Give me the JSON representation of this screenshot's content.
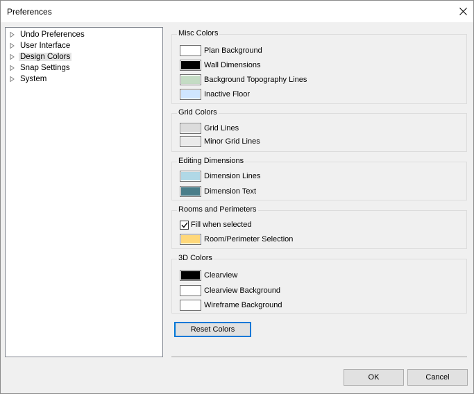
{
  "window": {
    "title": "Preferences",
    "close_icon": "close-icon"
  },
  "tree": {
    "items": [
      {
        "label": "Undo Preferences"
      },
      {
        "label": "User Interface"
      },
      {
        "label": "Design Colors",
        "selected": true
      },
      {
        "label": "Snap Settings"
      },
      {
        "label": "System"
      }
    ]
  },
  "groups": {
    "misc": {
      "title": "Misc Colors",
      "items": [
        {
          "label": "Plan Background",
          "color": "#ffffff"
        },
        {
          "label": "Wall Dimensions",
          "color": "#000000"
        },
        {
          "label": "Background Topography Lines",
          "color": "#c4dcc4"
        },
        {
          "label": "Inactive Floor",
          "color": "#cfe6ff"
        }
      ]
    },
    "grid": {
      "title": "Grid Colors",
      "items": [
        {
          "label": "Grid Lines",
          "color": "#dcdcdc"
        },
        {
          "label": "Minor Grid Lines",
          "color": "#eaeaea"
        }
      ]
    },
    "editing": {
      "title": "Editing Dimensions",
      "items": [
        {
          "label": "Dimension Lines",
          "color": "#b0d8e6"
        },
        {
          "label": "Dimension Text",
          "color": "#4a7e8a"
        }
      ]
    },
    "rooms": {
      "title": "Rooms and Perimeters",
      "fill_label": "Fill when selected",
      "fill_checked": true,
      "items": [
        {
          "label": "Room/Perimeter Selection",
          "color": "#ffd87a"
        }
      ]
    },
    "threed": {
      "title": "3D Colors",
      "items": [
        {
          "label": "Clearview",
          "color": "#000000"
        },
        {
          "label": "Clearview Background",
          "color": "#ffffff"
        },
        {
          "label": "Wireframe Background",
          "color": "#ffffff"
        }
      ]
    }
  },
  "buttons": {
    "reset": "Reset Colors",
    "ok": "OK",
    "cancel": "Cancel"
  }
}
